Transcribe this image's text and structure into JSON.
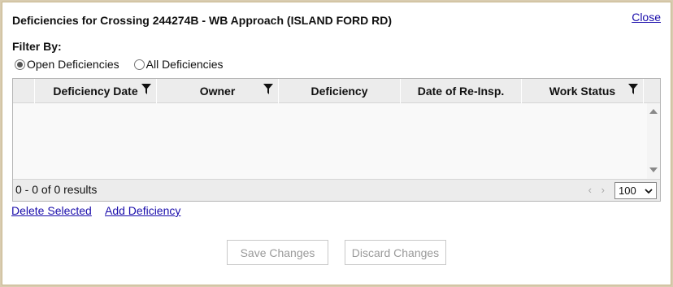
{
  "dialog": {
    "title": "Deficiencies for Crossing 244274B - WB Approach (ISLAND FORD RD)",
    "close_label": "Close"
  },
  "filter": {
    "label": "Filter By:",
    "options": [
      {
        "label": "Open Deficiencies",
        "checked": true
      },
      {
        "label": "All Deficiencies",
        "checked": false
      }
    ]
  },
  "grid": {
    "columns": [
      {
        "label": "",
        "filterable": false
      },
      {
        "label": "Deficiency Date",
        "filterable": true
      },
      {
        "label": "Owner",
        "filterable": true
      },
      {
        "label": "Deficiency",
        "filterable": false
      },
      {
        "label": "Date of Re-Insp.",
        "filterable": false
      },
      {
        "label": "Work Status",
        "filterable": true
      }
    ],
    "rows": [],
    "results_text": "0 - 0 of 0 results",
    "pager_prev": "‹",
    "pager_next": "›",
    "page_size": "100"
  },
  "actions": {
    "delete_selected": "Delete Selected",
    "add_deficiency": "Add Deficiency",
    "save_changes": "Save Changes",
    "discard_changes": "Discard Changes"
  },
  "colors": {
    "link": "#1a0dab",
    "header_bg": "#ececec",
    "disabled_text": "#9a9a9a"
  }
}
